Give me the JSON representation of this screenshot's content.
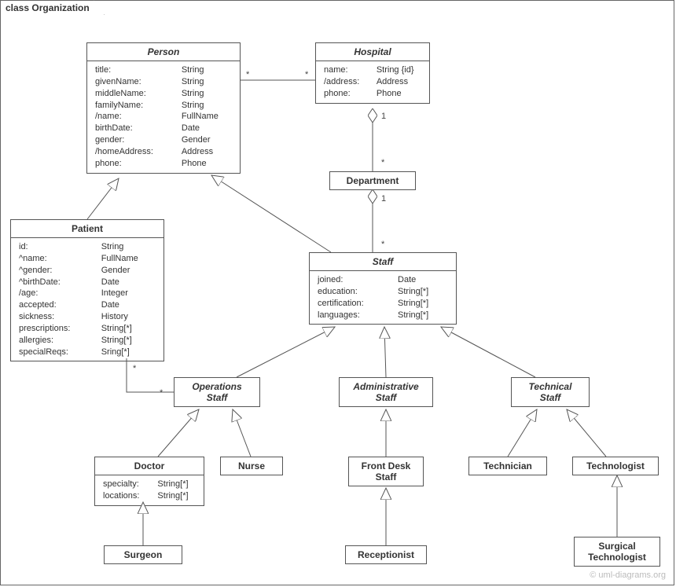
{
  "frame": {
    "title": "class Organization"
  },
  "watermark": "© uml-diagrams.org",
  "classes": {
    "person": {
      "name": "Person",
      "attrs": [
        [
          "title:",
          "String"
        ],
        [
          "givenName:",
          "String"
        ],
        [
          "middleName:",
          "String"
        ],
        [
          "familyName:",
          "String"
        ],
        [
          "/name:",
          "FullName"
        ],
        [
          "birthDate:",
          "Date"
        ],
        [
          "gender:",
          "Gender"
        ],
        [
          "/homeAddress:",
          "Address"
        ],
        [
          "phone:",
          "Phone"
        ]
      ]
    },
    "hospital": {
      "name": "Hospital",
      "attrs": [
        [
          "name:",
          "String {id}"
        ],
        [
          "/address:",
          "Address"
        ],
        [
          "phone:",
          "Phone"
        ]
      ]
    },
    "department": {
      "name": "Department",
      "attrs": []
    },
    "patient": {
      "name": "Patient",
      "attrs": [
        [
          "id:",
          "String"
        ],
        [
          "^name:",
          "FullName"
        ],
        [
          "^gender:",
          "Gender"
        ],
        [
          "^birthDate:",
          "Date"
        ],
        [
          "/age:",
          "Integer"
        ],
        [
          "accepted:",
          "Date"
        ],
        [
          "sickness:",
          "History"
        ],
        [
          "prescriptions:",
          "String[*]"
        ],
        [
          "allergies:",
          "String[*]"
        ],
        [
          "specialReqs:",
          "Sring[*]"
        ]
      ]
    },
    "staff": {
      "name": "Staff",
      "attrs": [
        [
          "joined:",
          "Date"
        ],
        [
          "education:",
          "String[*]"
        ],
        [
          "certification:",
          "String[*]"
        ],
        [
          "languages:",
          "String[*]"
        ]
      ]
    },
    "operationsStaff": {
      "name": "Operations\nStaff"
    },
    "administrativeStaff": {
      "name": "Administrative\nStaff"
    },
    "technicalStaff": {
      "name": "Technical\nStaff"
    },
    "doctor": {
      "name": "Doctor",
      "attrs": [
        [
          "specialty:",
          "String[*]"
        ],
        [
          "locations:",
          "String[*]"
        ]
      ]
    },
    "nurse": {
      "name": "Nurse"
    },
    "frontDeskStaff": {
      "name": "Front Desk\nStaff"
    },
    "receptionist": {
      "name": "Receptionist"
    },
    "technician": {
      "name": "Technician"
    },
    "technologist": {
      "name": "Technologist"
    },
    "surgicalTechnologist": {
      "name": "Surgical\nTechnologist"
    }
  },
  "mult": {
    "m1": "*",
    "m2": "*",
    "m3": "1",
    "m4": "*",
    "m5": "1",
    "m6": "*",
    "m7": "*",
    "m8": "*"
  }
}
